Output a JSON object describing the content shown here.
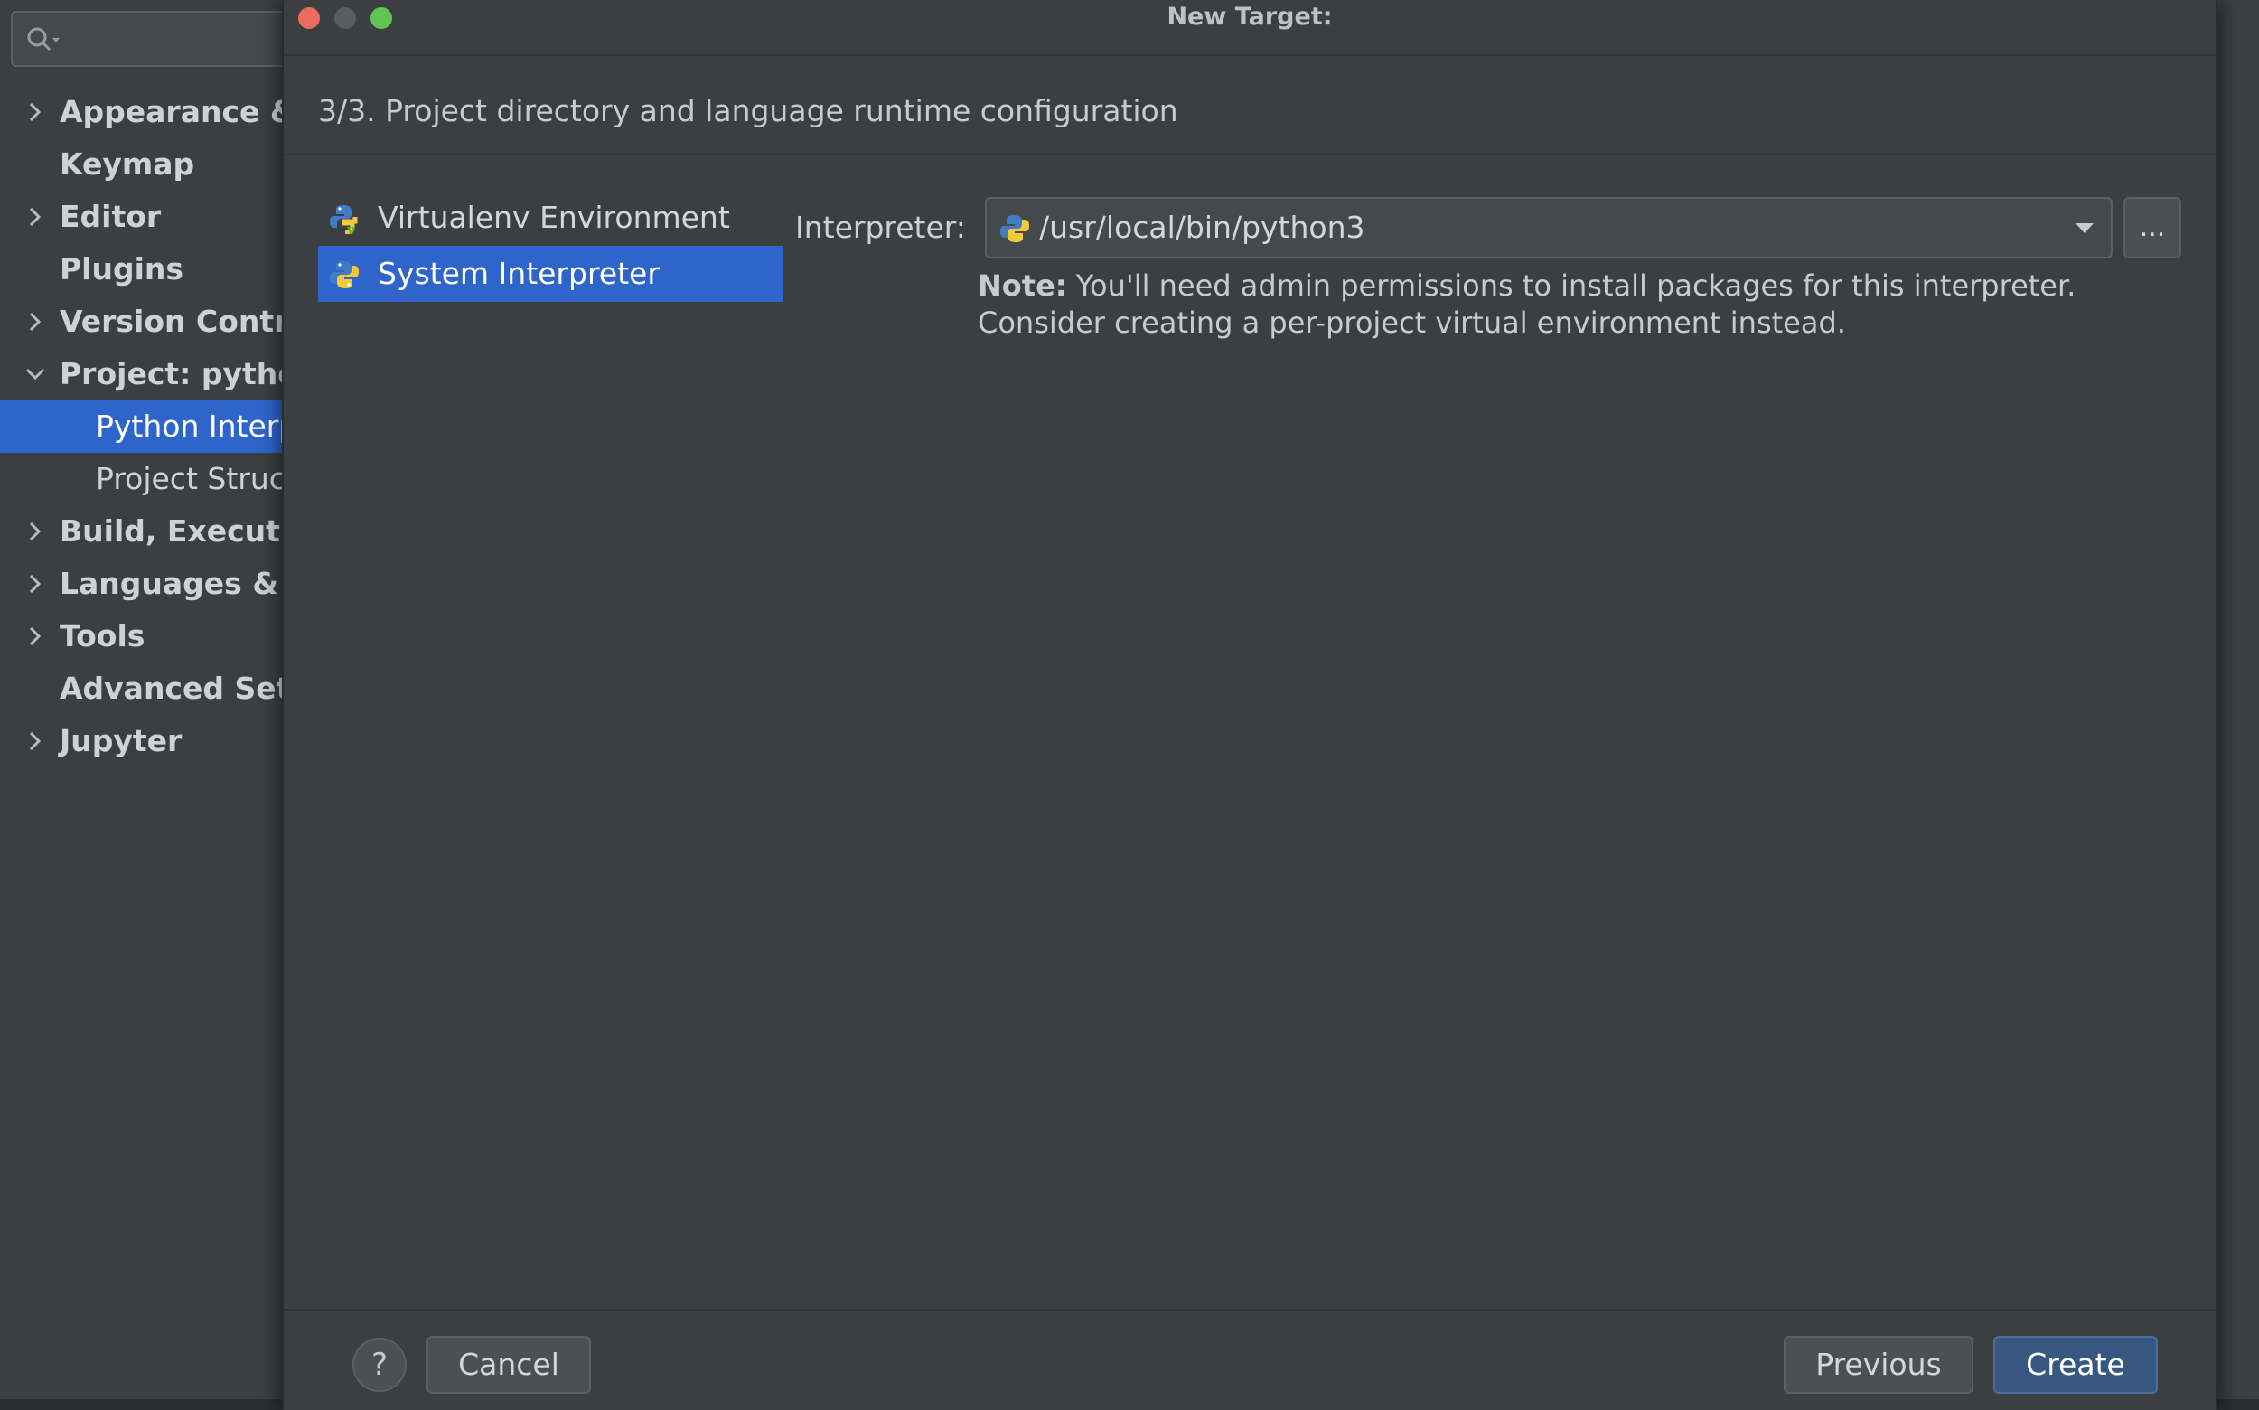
{
  "dialog": {
    "title": "New Target:",
    "step_header": "3/3. Project directory and language runtime configuration"
  },
  "settings_sidebar": {
    "items": [
      {
        "label": "Appearance & Behavior",
        "expandable": true
      },
      {
        "label": "Keymap",
        "expandable": false
      },
      {
        "label": "Editor",
        "expandable": true
      },
      {
        "label": "Plugins",
        "expandable": false
      },
      {
        "label": "Version Control",
        "expandable": true
      },
      {
        "label": "Project: python",
        "expandable": true,
        "expanded": true
      },
      {
        "label": "Python Interpreter",
        "child": true,
        "selected": true
      },
      {
        "label": "Project Structure",
        "child": true
      },
      {
        "label": "Build, Execution, Deployment",
        "expandable": true
      },
      {
        "label": "Languages & Frameworks",
        "expandable": true
      },
      {
        "label": "Tools",
        "expandable": true
      },
      {
        "label": "Advanced Settings",
        "expandable": false
      },
      {
        "label": "Jupyter",
        "expandable": true
      }
    ]
  },
  "environments": [
    {
      "label": "Virtualenv Environment",
      "icon": "python-virtualenv-icon",
      "selected": false
    },
    {
      "label": "System Interpreter",
      "icon": "python-icon",
      "selected": true
    }
  ],
  "interpreter": {
    "label": "Interpreter:",
    "value": "/usr/local/bin/python3",
    "browse_label": "..."
  },
  "note": {
    "bold": "Note:",
    "text": " You'll need admin permissions to install packages for this interpreter. Consider creating a per-project virtual environment instead."
  },
  "footer": {
    "help_label": "?",
    "cancel_label": "Cancel",
    "previous_label": "Previous",
    "create_label": "Create"
  },
  "colors": {
    "selection": "#2f65ca",
    "background": "#3c3f41",
    "create_button": "#365880"
  }
}
